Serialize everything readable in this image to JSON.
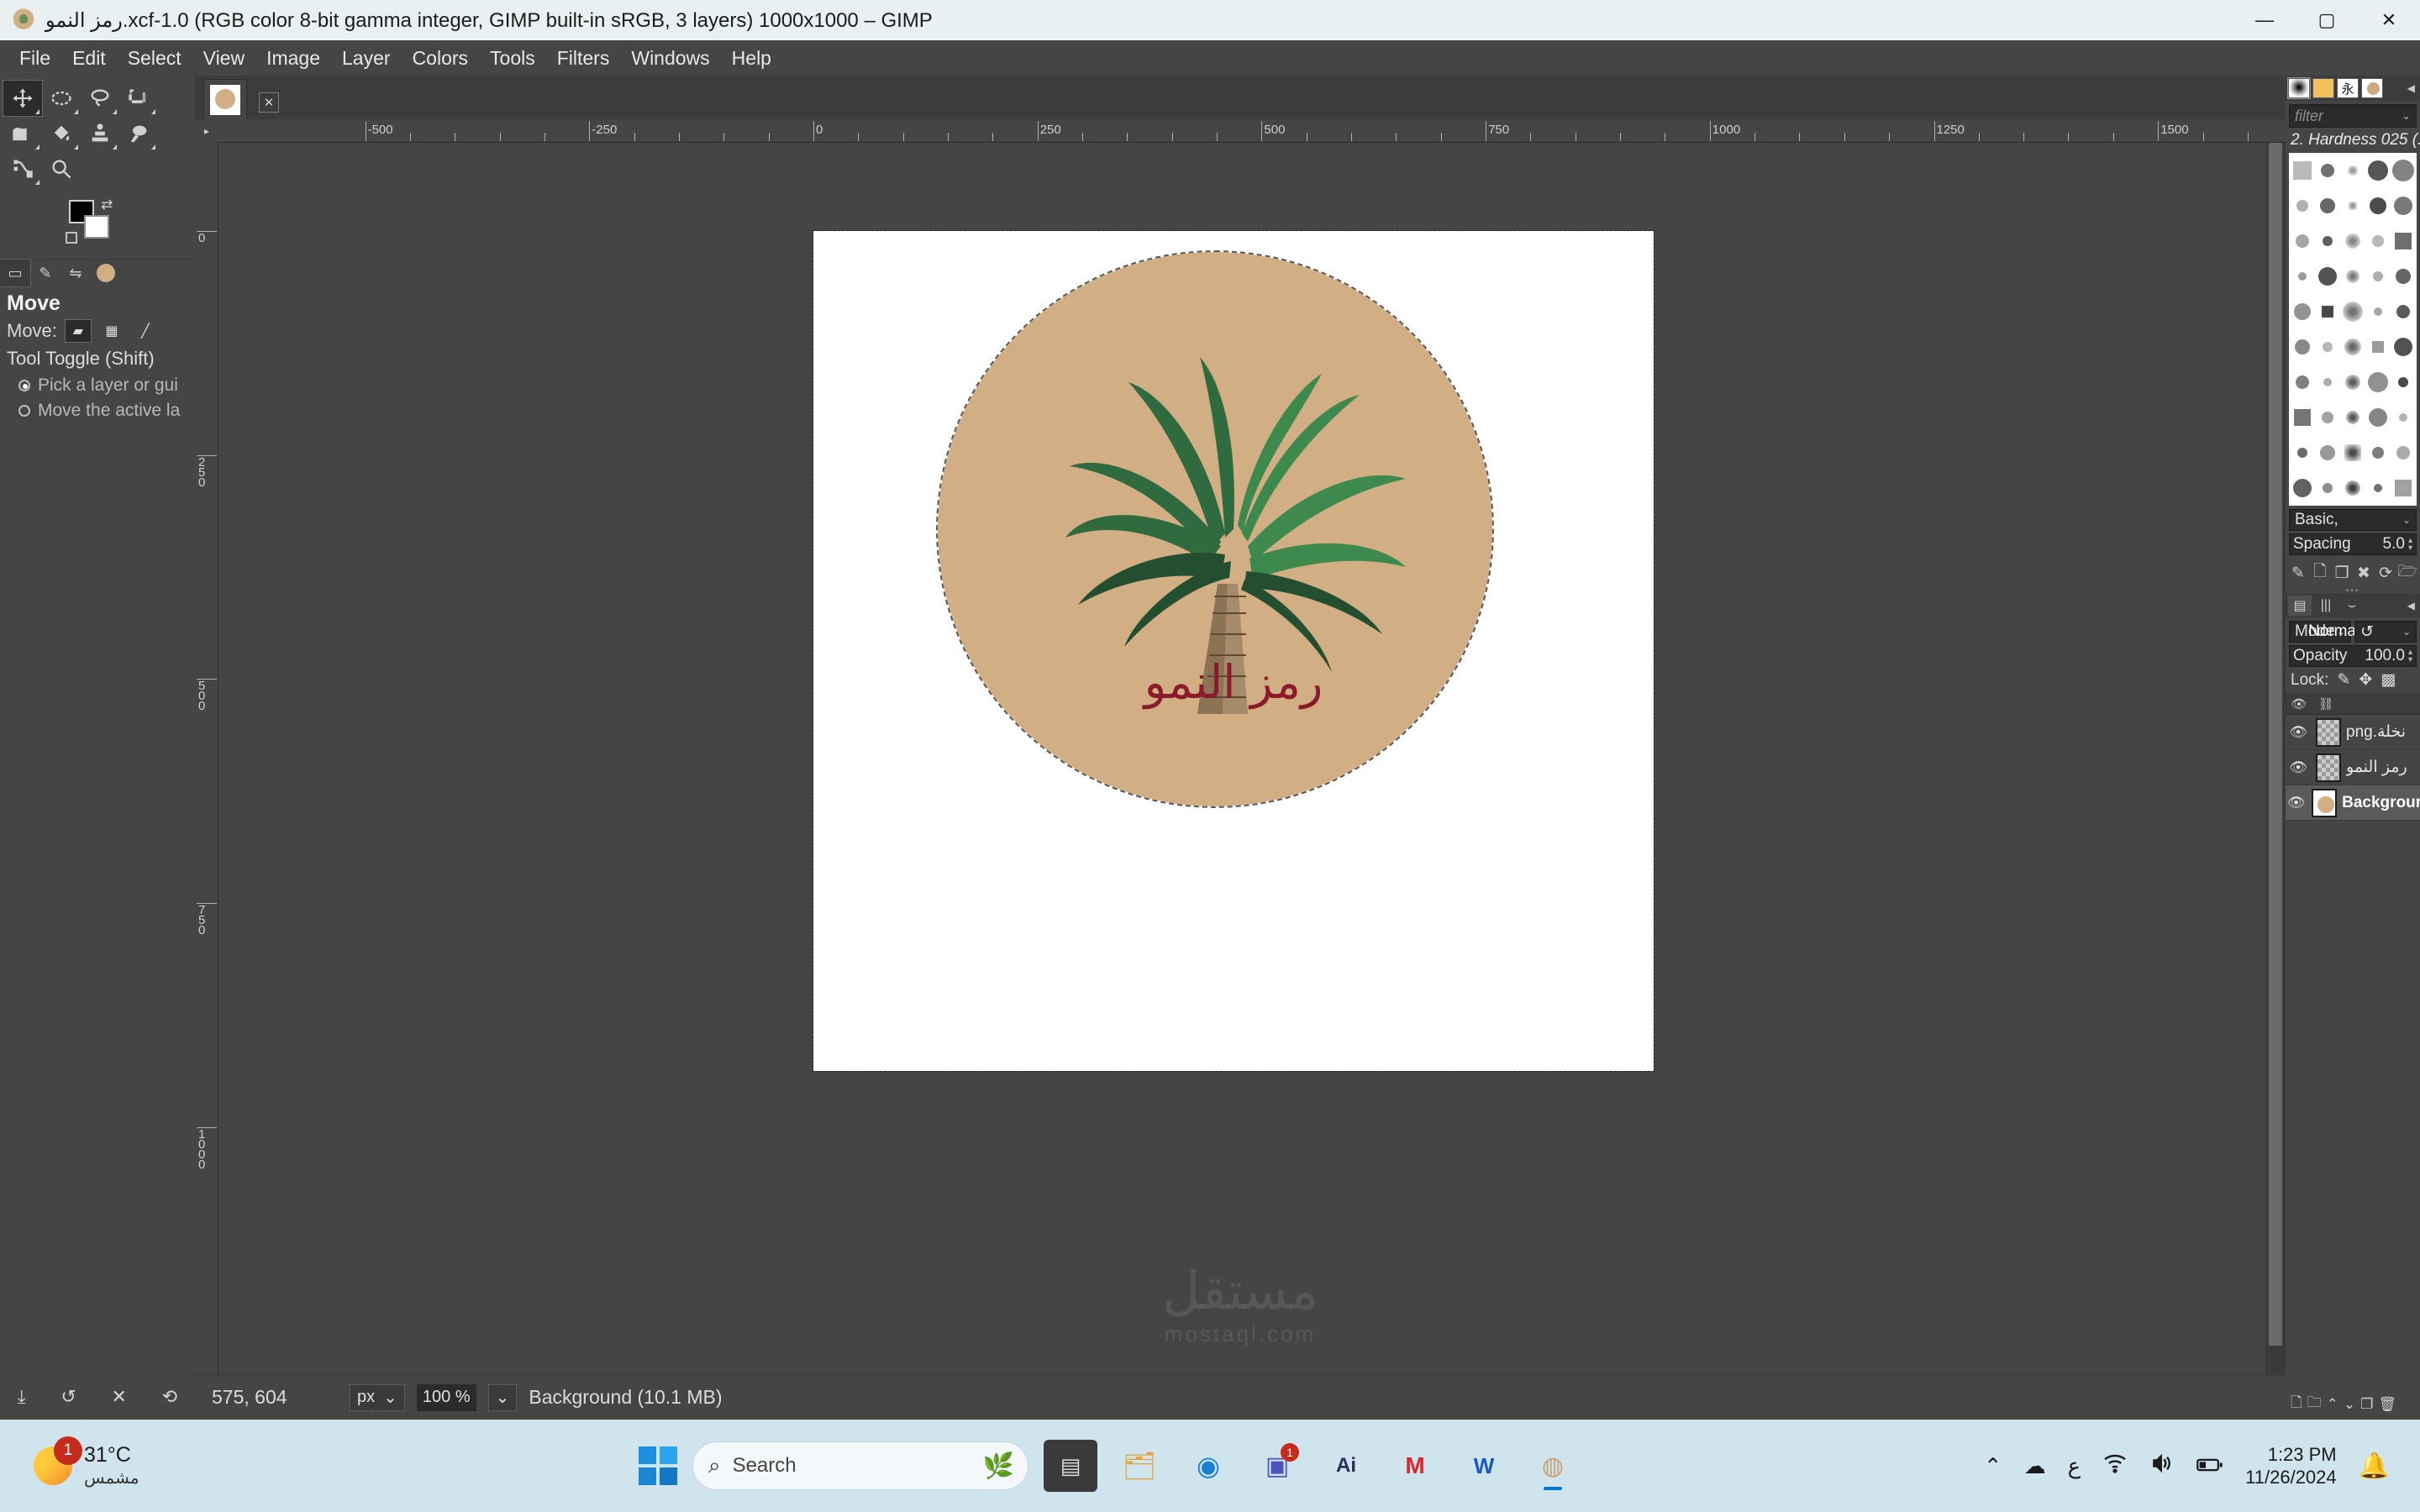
{
  "titlebar": {
    "title": "رمز النمو.xcf-1.0 (RGB color 8-bit gamma integer, GIMP built-in sRGB, 3 layers) 1000x1000 – GIMP",
    "minimize": "—",
    "maximize": "▢",
    "close": "✕"
  },
  "menubar": {
    "items": [
      {
        "label": "File"
      },
      {
        "label": "Edit"
      },
      {
        "label": "Select"
      },
      {
        "label": "View"
      },
      {
        "label": "Image"
      },
      {
        "label": "Layer"
      },
      {
        "label": "Colors"
      },
      {
        "label": "Tools"
      },
      {
        "label": "Filters"
      },
      {
        "label": "Windows"
      },
      {
        "label": "Help"
      }
    ]
  },
  "toolbox": {
    "tools": [
      {
        "name": "move-tool",
        "active": true
      },
      {
        "name": "free-select-tool",
        "active": false
      },
      {
        "name": "lasso-select-tool",
        "active": false
      },
      {
        "name": "crop-tool",
        "active": false
      },
      {
        "name": "warp-transform-tool",
        "active": false
      },
      {
        "name": "bucket-fill-tool",
        "active": false
      },
      {
        "name": "clone-tool",
        "active": false
      },
      {
        "name": "smudge-tool",
        "active": false
      },
      {
        "name": "paths-tool",
        "active": false
      },
      {
        "name": "zoom-tool",
        "active": false
      }
    ],
    "foreground_color": "#000000",
    "background_color": "#ffffff"
  },
  "tool_options": {
    "title": "Move",
    "move_label": "Move:",
    "move_modes": [
      "layer",
      "selection",
      "path"
    ],
    "tool_toggle_label": "Tool Toggle  (Shift)",
    "radios": [
      {
        "label": "Pick a layer or gui",
        "selected": true
      },
      {
        "label": "Move the active la",
        "selected": false
      }
    ]
  },
  "canvas": {
    "ruler_ticks_h": [
      "-500",
      "-250",
      "0",
      "250",
      "500",
      "750",
      "1000",
      "1250",
      "1500"
    ],
    "ruler_ticks_v": [
      "0",
      "250",
      "500",
      "750",
      "1000"
    ],
    "image_label": "رمز النمو",
    "circle_color": "#d2ae85",
    "text_color": "#8b1a2b",
    "watermark_line1": "مستقل",
    "watermark_line2": "mostaql.com"
  },
  "brushes": {
    "tabs": [
      "brushes-tab",
      "patterns-tab",
      "fonts-tab",
      "images-tab"
    ],
    "font_tab_glyph": "永",
    "filter_placeholder": "filter",
    "selected_brush": "2. Hardness 025 (...",
    "basic_label": "Basic,",
    "spacing_label": "Spacing",
    "spacing_value": "5.0"
  },
  "layers_panel": {
    "mode_label": "Mode",
    "mode_value": "Normal",
    "opacity_label": "Opacity",
    "opacity_value": "100.0",
    "lock_label": "Lock:",
    "items": [
      {
        "name": "نخلة.png",
        "visible": true,
        "selected": false,
        "kind": "transparent"
      },
      {
        "name": "رمز النمو",
        "visible": true,
        "selected": false,
        "kind": "transparent"
      },
      {
        "name": "Background",
        "visible": true,
        "selected": true,
        "kind": "background"
      }
    ]
  },
  "statusbar": {
    "position": "575, 604",
    "unit": "px",
    "zoom": "100 %",
    "status_text": "Background (10.1 MB)"
  },
  "taskbar": {
    "weather_temp": "31°C",
    "weather_desc": "مشمس",
    "weather_badge": "1",
    "search_placeholder": "Search",
    "apps": [
      {
        "name": "task-view",
        "glyph": "▤",
        "badge": "",
        "active": false
      },
      {
        "name": "file-explorer",
        "glyph": "🗂",
        "badge": "",
        "active": false
      },
      {
        "name": "edge-browser",
        "glyph": "◉",
        "badge": "",
        "active": false
      },
      {
        "name": "teams",
        "glyph": "▣",
        "badge": "1",
        "active": false
      },
      {
        "name": "illustrator",
        "glyph": "Ai",
        "badge": "",
        "active": false
      },
      {
        "name": "mega",
        "glyph": "M",
        "badge": "",
        "active": false
      },
      {
        "name": "word",
        "glyph": "W",
        "badge": "",
        "active": false
      },
      {
        "name": "gimp",
        "glyph": "◍",
        "badge": "",
        "active": true
      }
    ],
    "tray": {
      "chevron": "⌃",
      "cloud": "☁",
      "language": "ع",
      "wifi": "◌",
      "volume": "◂",
      "battery": "▭"
    },
    "time": "1:23 PM",
    "date": "11/26/2024"
  }
}
